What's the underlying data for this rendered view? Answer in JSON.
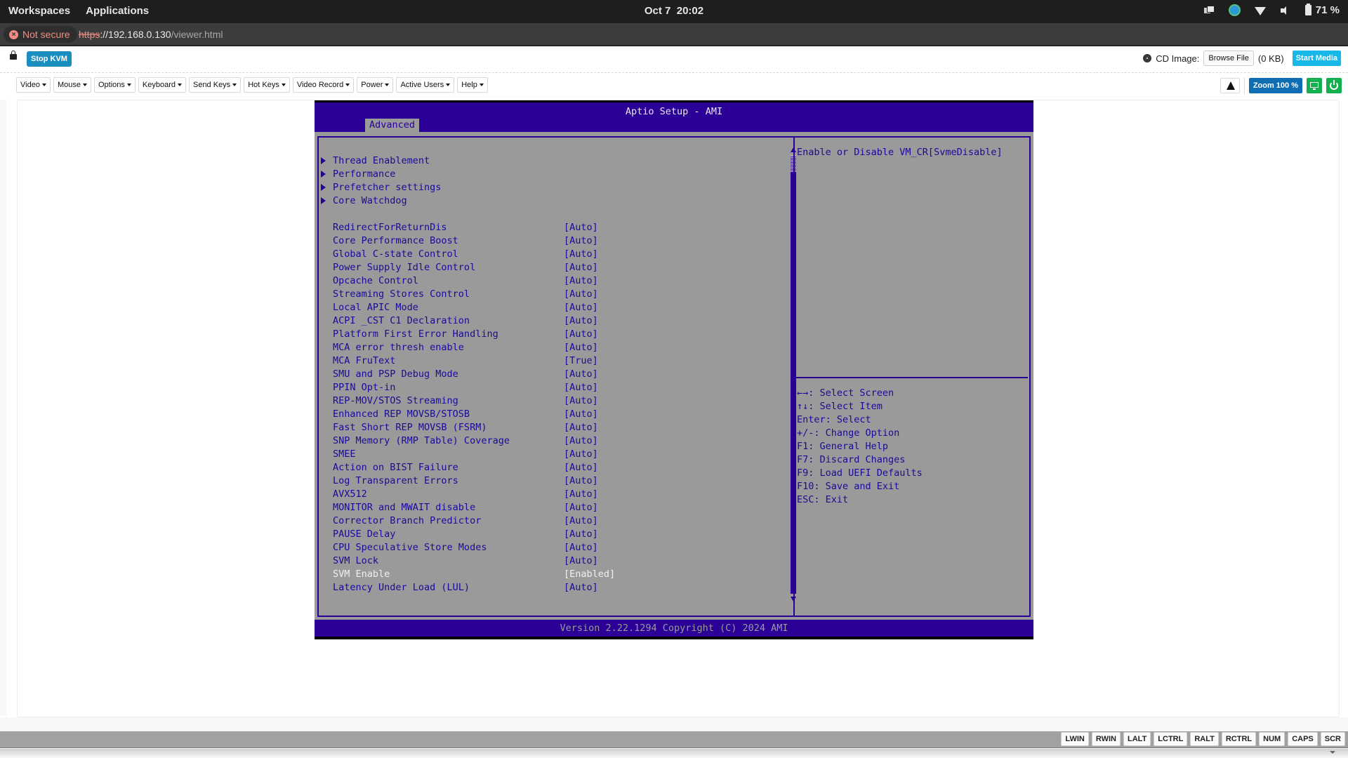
{
  "topbar": {
    "workspaces": "Workspaces",
    "applications": "Applications",
    "date": "Oct 7",
    "time": "20:02",
    "battery": "71 %",
    "tray_icons": [
      "window-switcher-icon",
      "app-indicator-icon",
      "wifi-icon",
      "volume-icon",
      "battery-icon"
    ]
  },
  "urlbar": {
    "security_label": "Not secure",
    "scheme": "https",
    "host": "://192.168.0.130",
    "path": "/viewer.html"
  },
  "kvm": {
    "stop_kvm": "Stop KVM",
    "cd_image_label": "CD Image:",
    "browse_file": "Browse File",
    "file_size": "(0 KB)",
    "start_media": "Start Media"
  },
  "toolbar": {
    "menus": [
      "Video",
      "Mouse",
      "Options",
      "Keyboard",
      "Send Keys",
      "Hot Keys",
      "Video Record",
      "Power",
      "Active Users",
      "Help"
    ],
    "zoom": "Zoom 100 %"
  },
  "bios": {
    "title": "Aptio Setup - AMI",
    "active_tab": "Advanced",
    "submenus": [
      "Thread Enablement",
      "Performance",
      "Prefetcher settings",
      "Core Watchdog"
    ],
    "settings": [
      {
        "label": "RedirectForReturnDis",
        "value": "[Auto]"
      },
      {
        "label": "Core Performance Boost",
        "value": "[Auto]"
      },
      {
        "label": "Global C-state Control",
        "value": "[Auto]"
      },
      {
        "label": "Power Supply Idle Control",
        "value": "[Auto]"
      },
      {
        "label": "Opcache Control",
        "value": "[Auto]"
      },
      {
        "label": "Streaming Stores Control",
        "value": "[Auto]"
      },
      {
        "label": "Local APIC Mode",
        "value": "[Auto]"
      },
      {
        "label": "ACPI _CST C1 Declaration",
        "value": "[Auto]"
      },
      {
        "label": "Platform First Error Handling",
        "value": "[Auto]"
      },
      {
        "label": "MCA error thresh enable",
        "value": "[Auto]"
      },
      {
        "label": "MCA FruText",
        "value": "[True]"
      },
      {
        "label": "SMU and PSP Debug Mode",
        "value": "[Auto]"
      },
      {
        "label": "PPIN Opt-in",
        "value": "[Auto]"
      },
      {
        "label": "REP-MOV/STOS Streaming",
        "value": "[Auto]"
      },
      {
        "label": "Enhanced REP MOVSB/STOSB",
        "value": "[Auto]"
      },
      {
        "label": "Fast Short REP MOVSB (FSRM)",
        "value": "[Auto]"
      },
      {
        "label": "SNP Memory (RMP Table) Coverage",
        "value": "[Auto]"
      },
      {
        "label": "SMEE",
        "value": "[Auto]"
      },
      {
        "label": "Action on BIST Failure",
        "value": "[Auto]"
      },
      {
        "label": "Log Transparent Errors",
        "value": "[Auto]"
      },
      {
        "label": "AVX512",
        "value": "[Auto]"
      },
      {
        "label": "MONITOR and MWAIT disable",
        "value": "[Auto]"
      },
      {
        "label": "Corrector Branch Predictor",
        "value": "[Auto]"
      },
      {
        "label": "PAUSE Delay",
        "value": "[Auto]"
      },
      {
        "label": "CPU Speculative Store Modes",
        "value": "[Auto]"
      },
      {
        "label": "SVM Lock",
        "value": "[Auto]"
      },
      {
        "label": "SVM Enable",
        "value": "[Enabled]",
        "selected": true
      },
      {
        "label": "Latency Under Load (LUL)",
        "value": "[Auto]"
      }
    ],
    "help_text": "Enable or Disable VM_CR[SvmeDisable]",
    "key_help": [
      "←→: Select Screen",
      "↑↓: Select Item",
      "Enter: Select",
      "+/-: Change Option",
      "F1: General Help",
      "F7: Discard Changes",
      "F9: Load UEFI Defaults",
      "F10: Save and Exit",
      "ESC: Exit"
    ],
    "footer": "Version 2.22.1294 Copyright (C) 2024 AMI",
    "colors": {
      "blue": "#2a0097",
      "gray": "#9a9a9a",
      "highlight": "#f0f0f0"
    }
  },
  "keybar": {
    "keys": [
      "LWIN",
      "RWIN",
      "LALT",
      "LCTRL",
      "RALT",
      "RCTRL",
      "NUM",
      "CAPS",
      "SCR"
    ]
  }
}
